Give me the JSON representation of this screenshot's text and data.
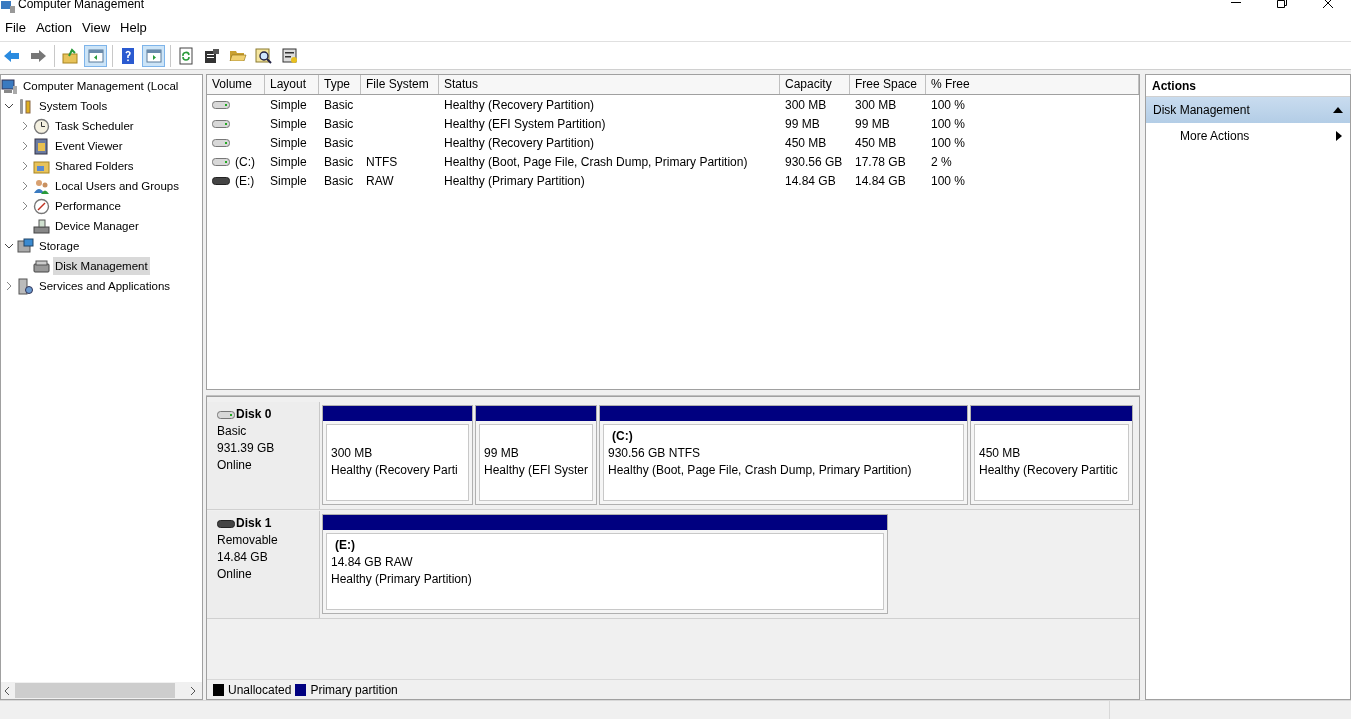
{
  "window": {
    "title": "Computer Management"
  },
  "menu": [
    {
      "label": "File"
    },
    {
      "label": "Action"
    },
    {
      "label": "View"
    },
    {
      "label": "Help"
    }
  ],
  "toolbar": [
    [
      {
        "kind": "back",
        "pressed": false
      },
      {
        "kind": "forward",
        "pressed": false
      }
    ],
    [
      {
        "kind": "up",
        "pressed": false
      },
      {
        "kind": "tree",
        "pressed": true
      }
    ],
    [
      {
        "kind": "help",
        "pressed": false
      },
      {
        "kind": "pane",
        "pressed": true
      }
    ],
    [
      {
        "kind": "refresh",
        "pressed": false
      },
      {
        "kind": "properties",
        "pressed": false
      },
      {
        "kind": "open",
        "pressed": false
      },
      {
        "kind": "find",
        "pressed": false
      },
      {
        "kind": "settings",
        "pressed": false
      }
    ]
  ],
  "tree": [
    {
      "label": "Computer Management (Local",
      "kind": "computer",
      "selected": false,
      "children": [
        {
          "label": "System Tools",
          "kind": "tools",
          "expanded": true,
          "selected": false,
          "children": [
            {
              "label": "Task Scheduler",
              "kind": "clock",
              "expanded": false,
              "selected": false
            },
            {
              "label": "Event Viewer",
              "kind": "event",
              "expanded": false,
              "selected": false
            },
            {
              "label": "Shared Folders",
              "kind": "folder",
              "expanded": false,
              "selected": false
            },
            {
              "label": "Local Users and Groups",
              "kind": "users",
              "expanded": false,
              "selected": false
            },
            {
              "label": "Performance",
              "kind": "performance",
              "expanded": false,
              "selected": false
            },
            {
              "label": "Device Manager",
              "kind": "device",
              "selected": false
            }
          ]
        },
        {
          "label": "Storage",
          "kind": "storage",
          "expanded": true,
          "selected": false,
          "children": [
            {
              "label": "Disk Management",
              "kind": "disk",
              "selected": true
            }
          ]
        },
        {
          "label": "Services and Applications",
          "kind": "services",
          "expanded": false,
          "selected": false
        }
      ]
    }
  ],
  "volumes": {
    "columns": [
      "Volume",
      "Layout",
      "Type",
      "File System",
      "Status",
      "Capacity",
      "Free Space",
      "% Free"
    ],
    "rows": [
      {
        "kind": "fixed",
        "layout": "Simple",
        "type": "Basic",
        "status": "Healthy (Recovery Partition)",
        "capacity": "300 MB",
        "free_space": "300 MB",
        "percent_free": "100 %"
      },
      {
        "kind": "fixed",
        "layout": "Simple",
        "type": "Basic",
        "status": "Healthy (EFI System Partition)",
        "capacity": "99 MB",
        "free_space": "99 MB",
        "percent_free": "100 %"
      },
      {
        "kind": "fixed",
        "layout": "Simple",
        "type": "Basic",
        "status": "Healthy (Recovery Partition)",
        "capacity": "450 MB",
        "free_space": "450 MB",
        "percent_free": "100 %"
      },
      {
        "kind": "fixed",
        "volume": "(C:)",
        "layout": "Simple",
        "type": "Basic",
        "file_system": "NTFS",
        "status": "Healthy (Boot, Page File, Crash Dump, Primary Partition)",
        "capacity": "930.56 GB",
        "free_space": "17.78 GB",
        "percent_free": "2 %"
      },
      {
        "kind": "removable",
        "volume": "(E:)",
        "layout": "Simple",
        "type": "Basic",
        "file_system": "RAW",
        "status": "Healthy (Primary Partition)",
        "capacity": "14.84 GB",
        "free_space": "14.84 GB",
        "percent_free": "100 %"
      }
    ]
  },
  "disks": [
    {
      "name": "Disk 0",
      "kind": "fixed",
      "type": "Basic",
      "size": "931.39 GB",
      "status": "Online",
      "partitions": [
        {
          "size": "300 MB",
          "status": "Healthy (Recovery Parti",
          "color": "#000080"
        },
        {
          "size": "99 MB",
          "status": "Healthy (EFI Syster",
          "color": "#000080"
        },
        {
          "label": "(C:)",
          "size": "930.56 GB NTFS",
          "status": "Healthy (Boot, Page File, Crash Dump, Primary Partition)",
          "color": "#000080"
        },
        {
          "size": "450 MB",
          "status": "Healthy (Recovery Partitic",
          "color": "#000080"
        }
      ]
    },
    {
      "name": "Disk 1",
      "kind": "removable",
      "type": "Removable",
      "size": "14.84 GB",
      "status": "Online",
      "partitions": [
        {
          "label": "(E:)",
          "size": "14.84 GB RAW",
          "status": "Healthy (Primary Partition)",
          "color": "#000080"
        }
      ]
    }
  ],
  "legend": [
    {
      "label": "Unallocated",
      "color": "#000000"
    },
    {
      "label": "Primary partition",
      "color": "#000080"
    }
  ],
  "actions": {
    "title": "Actions",
    "sections": [
      {
        "label": "Disk Management",
        "expanded": true,
        "items": [
          {
            "label": "More Actions"
          }
        ]
      }
    ]
  }
}
